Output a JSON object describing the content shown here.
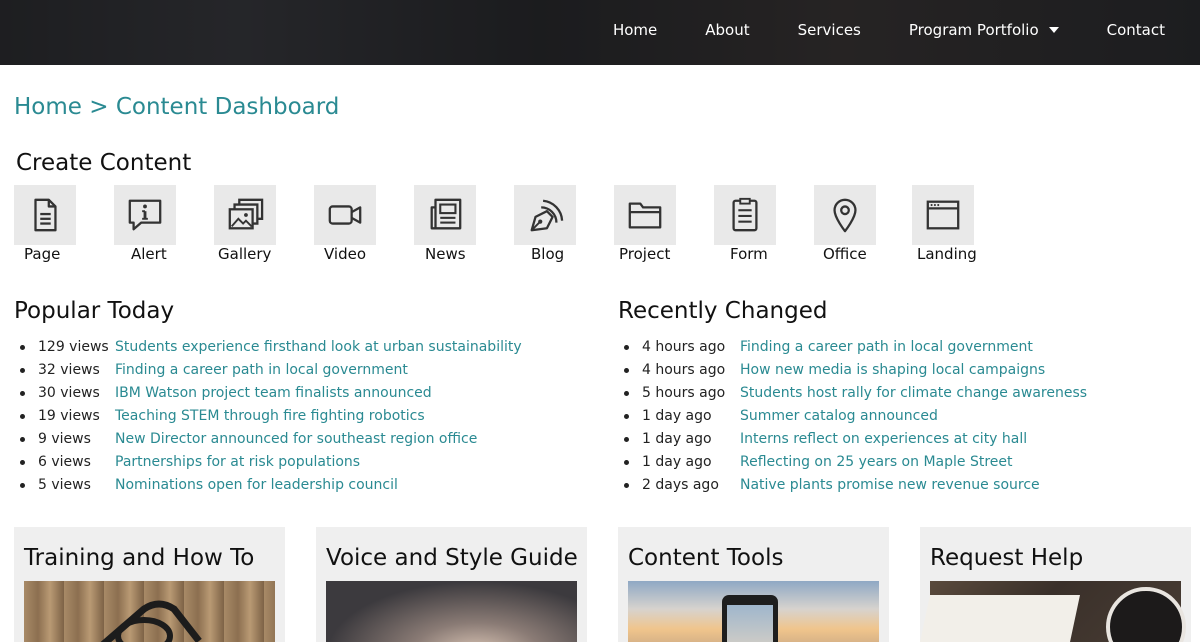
{
  "nav": {
    "items": [
      "Home",
      "About",
      "Services",
      "Program Portfolio",
      "Contact"
    ]
  },
  "breadcrumb": {
    "home": "Home",
    "separator": ">",
    "current": "Content Dashboard"
  },
  "create_content": {
    "title": "Create Content",
    "tiles": [
      {
        "label": "Page",
        "icon": "page-icon"
      },
      {
        "label": "Alert",
        "icon": "alert-icon"
      },
      {
        "label": "Gallery",
        "icon": "gallery-icon"
      },
      {
        "label": "Video",
        "icon": "video-icon"
      },
      {
        "label": "News",
        "icon": "news-icon"
      },
      {
        "label": "Blog",
        "icon": "blog-icon"
      },
      {
        "label": "Project",
        "icon": "folder-icon"
      },
      {
        "label": "Form",
        "icon": "form-icon"
      },
      {
        "label": "Office",
        "icon": "location-pin-icon"
      },
      {
        "label": "Landing",
        "icon": "browser-window-icon"
      }
    ]
  },
  "popular_today": {
    "title": "Popular Today",
    "items": [
      {
        "meta": "129 views",
        "link": "Students experience firsthand look at urban sustainability"
      },
      {
        "meta": "32 views",
        "link": "Finding a career path in local government"
      },
      {
        "meta": "30 views",
        "link": "IBM Watson project team finalists announced"
      },
      {
        "meta": "19 views",
        "link": "Teaching STEM through fire fighting robotics"
      },
      {
        "meta": "9 views",
        "link": "New Director announced for southeast region office"
      },
      {
        "meta": "6 views",
        "link": "Partnerships for at risk populations"
      },
      {
        "meta": "5 views",
        "link": "Nominations open for leadership council"
      }
    ]
  },
  "recently_changed": {
    "title": "Recently Changed",
    "items": [
      {
        "meta": "4 hours ago",
        "link": "Finding a career path in local government"
      },
      {
        "meta": "4 hours ago",
        "link": "How new media is shaping local campaigns"
      },
      {
        "meta": "5 hours ago",
        "link": "Students host rally for climate change awareness"
      },
      {
        "meta": "1 day ago",
        "link": "Summer catalog announced"
      },
      {
        "meta": "1 day ago",
        "link": "Interns reflect on experiences at city hall"
      },
      {
        "meta": "1 day ago",
        "link": "Reflecting on 25 years on Maple Street"
      },
      {
        "meta": "2 days ago",
        "link": "Native plants promise new revenue source"
      }
    ]
  },
  "cards": [
    {
      "title": "Training and How To"
    },
    {
      "title": "Voice and Style Guide"
    },
    {
      "title": "Content Tools"
    },
    {
      "title": "Request Help"
    }
  ],
  "colors": {
    "link": "#2a8a92",
    "header_bg": "#2e2f33",
    "tile_bg": "#e9e9e9",
    "card_bg": "#efefef"
  }
}
